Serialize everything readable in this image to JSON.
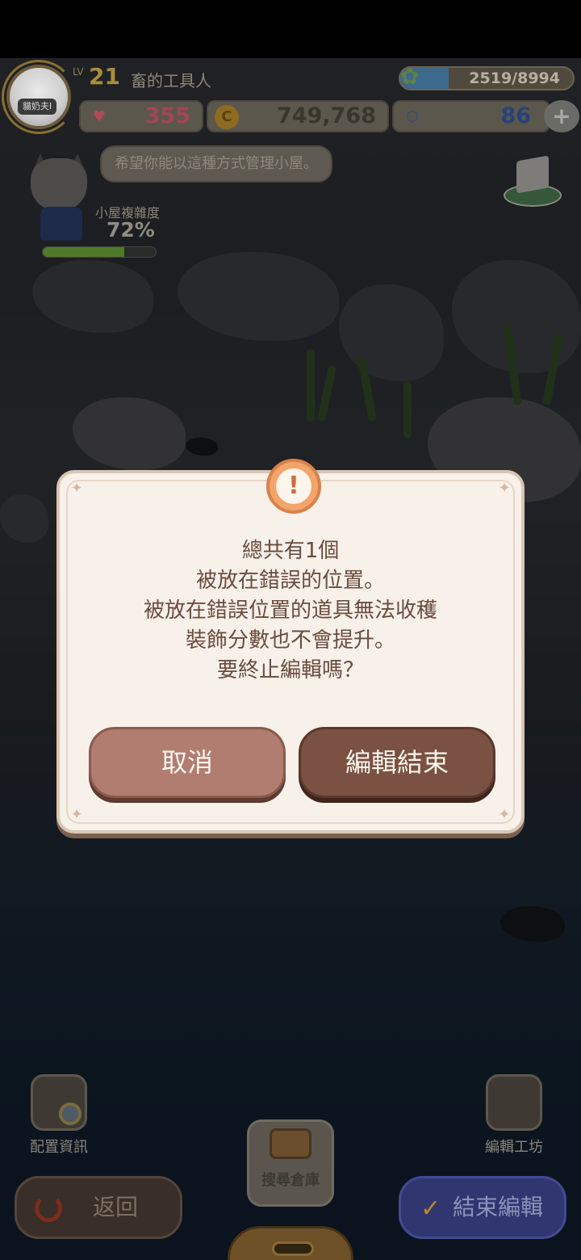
{
  "hud": {
    "level_prefix": "LV",
    "level": "21",
    "player_name": "畜的工具人",
    "avatar_tag": "貓奶夫I",
    "exp_text": "2519/8994",
    "exp_fraction": 0.28,
    "hearts": "355",
    "coins": "749,768",
    "gems": "86",
    "plus": "+"
  },
  "npc": {
    "speech": "希望你能以這種方式管理小屋。",
    "complexity_label": "小屋複雜度",
    "complexity_value": "72%",
    "complexity_fraction": 0.72
  },
  "dialog": {
    "icon": "!",
    "message_lines": [
      "總共有1個",
      "被放在錯誤的位置。",
      "被放在錯誤位置的道具無法收穫",
      "裝飾分數也不會提升。",
      "要終止編輯嗎？"
    ],
    "cancel_label": "取消",
    "confirm_label": "編輯結束"
  },
  "bottom": {
    "layout_info_label": "配置資訊",
    "edit_workshop_label": "編輯工坊",
    "storage_label": "搜尋倉庫",
    "back_label": "返回",
    "finish_label": "結束編輯"
  },
  "icons": {
    "heart": "heart-icon",
    "coin": "coin-icon",
    "gem": "gem-icon",
    "warning": "warning-icon",
    "back": "undo-icon",
    "check": "check-icon"
  },
  "colors": {
    "dialog_bg": "#f7f1ea",
    "cancel_button": "#b17d70",
    "confirm_button": "#7a5142",
    "dialog_text": "#6b4b3e",
    "finish_button": "#2f3670"
  }
}
